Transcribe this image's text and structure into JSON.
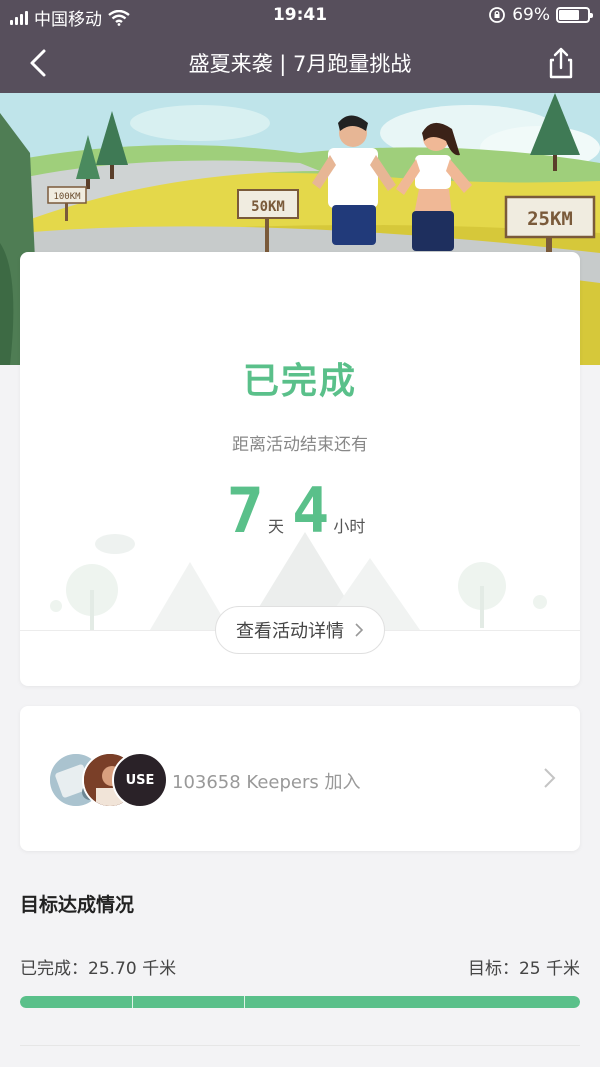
{
  "status_bar": {
    "carrier": "中国移动",
    "time": "19:41",
    "battery": "69%"
  },
  "nav": {
    "title": "盛夏来袭 | 7月跑量挑战"
  },
  "hero": {
    "signs": [
      "100KM",
      "50KM",
      "25KM"
    ]
  },
  "status_card": {
    "status": "已完成",
    "remaining_label": "距离活动结束还有",
    "days": "7",
    "days_unit": "天",
    "hours": "4",
    "hours_unit": "小时",
    "detail_button": "查看活动详情"
  },
  "participants": {
    "text": "103658 Keepers 加入",
    "avatar3_text": "USE"
  },
  "goal": {
    "title": "目标达成情况",
    "completed": "已完成：25.70 千米",
    "target": "目标：25 千米",
    "progress_fraction": 1.0
  },
  "colors": {
    "accent": "#5ac08a",
    "nav_bg": "#574f5c"
  }
}
